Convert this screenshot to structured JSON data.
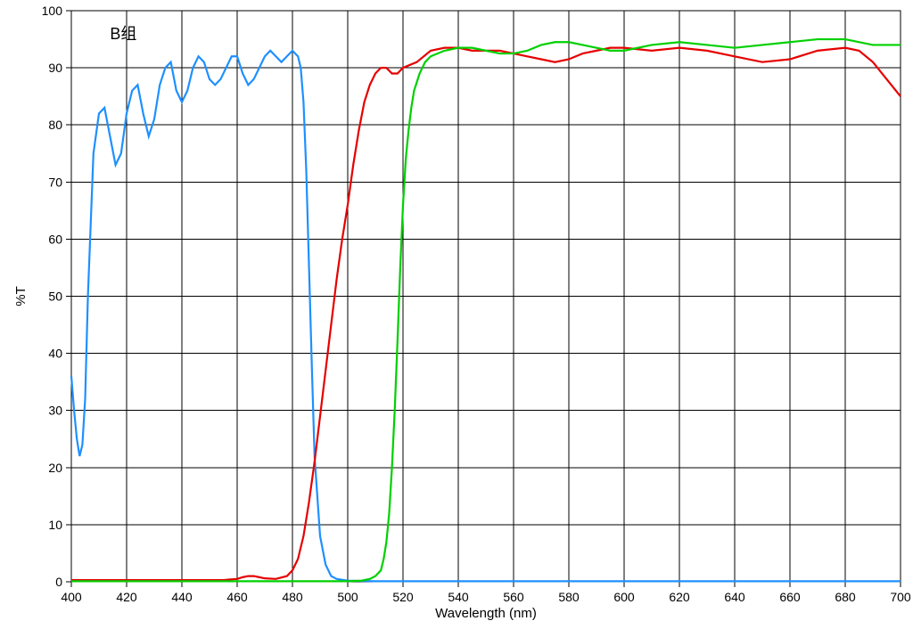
{
  "chart_data": {
    "type": "line",
    "title": "",
    "annotation": "B组",
    "xlabel": "Wavelength (nm)",
    "ylabel": "%T",
    "xlim": [
      400,
      700
    ],
    "ylim": [
      0,
      100
    ],
    "xticks": [
      400,
      420,
      440,
      460,
      480,
      500,
      520,
      540,
      560,
      580,
      600,
      620,
      640,
      660,
      680,
      700
    ],
    "yticks": [
      0,
      10,
      20,
      30,
      40,
      50,
      60,
      70,
      80,
      90,
      100
    ],
    "series": [
      {
        "name": "blue",
        "color": "#1e90ff",
        "x": [
          400,
          401,
          402,
          403,
          404,
          405,
          406,
          408,
          410,
          412,
          414,
          416,
          418,
          420,
          422,
          424,
          426,
          428,
          430,
          432,
          434,
          436,
          438,
          440,
          442,
          444,
          446,
          448,
          450,
          452,
          454,
          456,
          458,
          460,
          462,
          464,
          466,
          468,
          470,
          472,
          474,
          476,
          478,
          480,
          482,
          483,
          484,
          485,
          486,
          487,
          488,
          490,
          492,
          494,
          496,
          500,
          510,
          520,
          540,
          600,
          700
        ],
        "y": [
          36,
          30,
          25,
          22,
          24,
          32,
          50,
          75,
          82,
          83,
          78,
          73,
          75,
          82,
          86,
          87,
          82,
          78,
          81,
          87,
          90,
          91,
          86,
          84,
          86,
          90,
          92,
          91,
          88,
          87,
          88,
          90,
          92,
          92,
          89,
          87,
          88,
          90,
          92,
          93,
          92,
          91,
          92,
          93,
          92,
          90,
          84,
          72,
          55,
          38,
          22,
          8,
          3,
          1,
          0.5,
          0.2,
          0.1,
          0.1,
          0.1,
          0.1,
          0.1
        ]
      },
      {
        "name": "red",
        "color": "#e60000",
        "x": [
          400,
          420,
          440,
          455,
          460,
          462,
          464,
          466,
          468,
          470,
          474,
          478,
          480,
          482,
          484,
          486,
          488,
          490,
          492,
          494,
          496,
          498,
          500,
          502,
          504,
          506,
          508,
          510,
          512,
          514,
          516,
          518,
          520,
          525,
          530,
          535,
          540,
          545,
          550,
          555,
          560,
          565,
          570,
          575,
          580,
          585,
          590,
          595,
          600,
          610,
          620,
          630,
          640,
          650,
          660,
          670,
          680,
          685,
          690,
          695,
          700
        ],
        "y": [
          0.3,
          0.3,
          0.3,
          0.3,
          0.5,
          0.8,
          1.0,
          1.0,
          0.8,
          0.6,
          0.5,
          1,
          2,
          4,
          8,
          14,
          21,
          29,
          37,
          45,
          53,
          60,
          66,
          73,
          79,
          84,
          87,
          89,
          90,
          90,
          89,
          89,
          90,
          91,
          93,
          93.5,
          93.5,
          93,
          93,
          93,
          92.5,
          92,
          91.5,
          91,
          91.5,
          92.5,
          93,
          93.5,
          93.5,
          93,
          93.5,
          93,
          92,
          91,
          91.5,
          93,
          93.5,
          93,
          91,
          88,
          85
        ]
      },
      {
        "name": "green",
        "color": "#00d000",
        "x": [
          400,
          440,
          480,
          500,
          505,
          508,
          510,
          512,
          513,
          514,
          515,
          516,
          517,
          518,
          519,
          520,
          521,
          522,
          523,
          524,
          526,
          528,
          530,
          535,
          540,
          545,
          550,
          555,
          560,
          565,
          570,
          575,
          580,
          585,
          590,
          595,
          600,
          610,
          620,
          630,
          640,
          650,
          660,
          670,
          680,
          690,
          700
        ],
        "y": [
          0.1,
          0.1,
          0.1,
          0.1,
          0.2,
          0.5,
          1,
          2,
          4,
          7,
          12,
          20,
          30,
          42,
          55,
          66,
          74,
          79,
          83,
          86,
          89,
          91,
          92,
          93,
          93.5,
          93.5,
          93,
          92.5,
          92.5,
          93,
          94,
          94.5,
          94.5,
          94,
          93.5,
          93,
          93,
          94,
          94.5,
          94,
          93.5,
          94,
          94.5,
          95,
          95,
          94,
          94
        ]
      }
    ]
  }
}
